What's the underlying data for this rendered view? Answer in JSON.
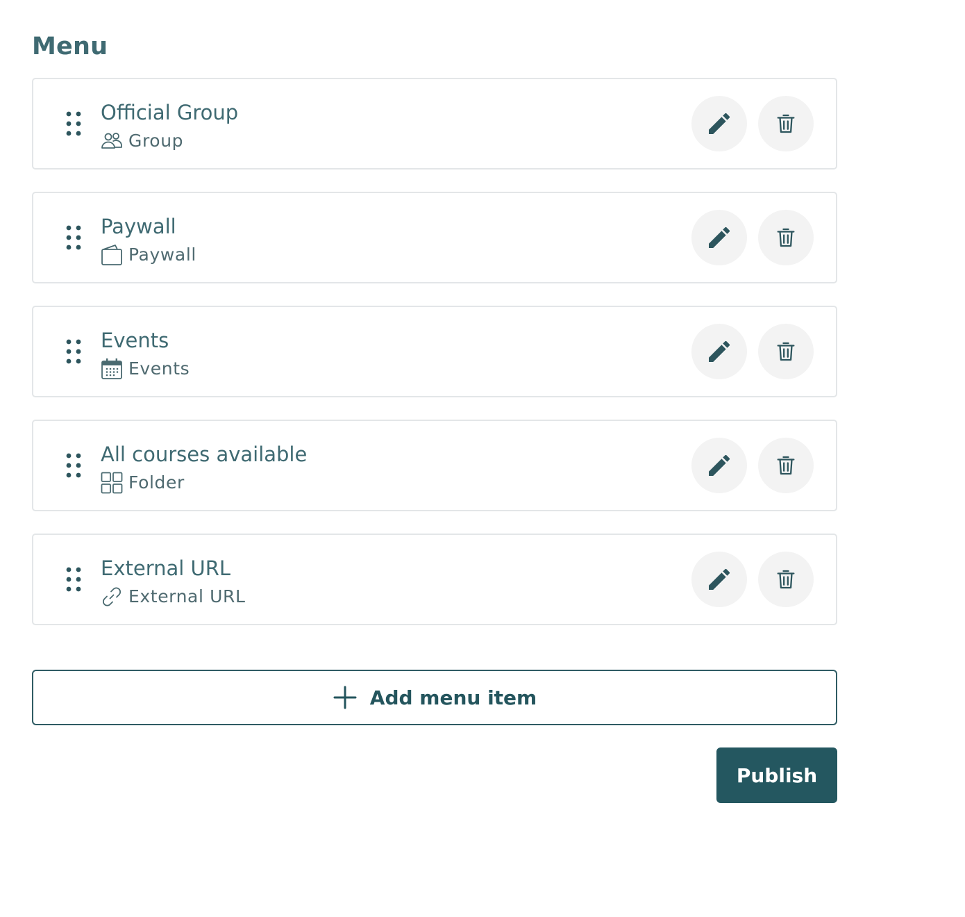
{
  "menu": {
    "title": "Menu",
    "items": [
      {
        "label": "Official Group",
        "type_label": "Group",
        "type_icon": "group-icon"
      },
      {
        "label": "Paywall",
        "type_label": "Paywall",
        "type_icon": "wallet-icon"
      },
      {
        "label": "Events",
        "type_label": "Events",
        "type_icon": "calendar-icon"
      },
      {
        "label": "All courses available",
        "type_label": "Folder",
        "type_icon": "grid-icon"
      },
      {
        "label": "External URL",
        "type_label": "External URL",
        "type_icon": "link-icon"
      }
    ],
    "item_actions": {
      "edit_icon": "pencil-icon",
      "delete_icon": "trash-icon"
    }
  },
  "actions": {
    "add_label": "Add menu item",
    "publish_label": "Publish"
  },
  "colors": {
    "heading": "#3f6a72",
    "primary": "#245760",
    "card_border": "#e3e6e8",
    "icon_button_bg": "#f3f3f3"
  }
}
